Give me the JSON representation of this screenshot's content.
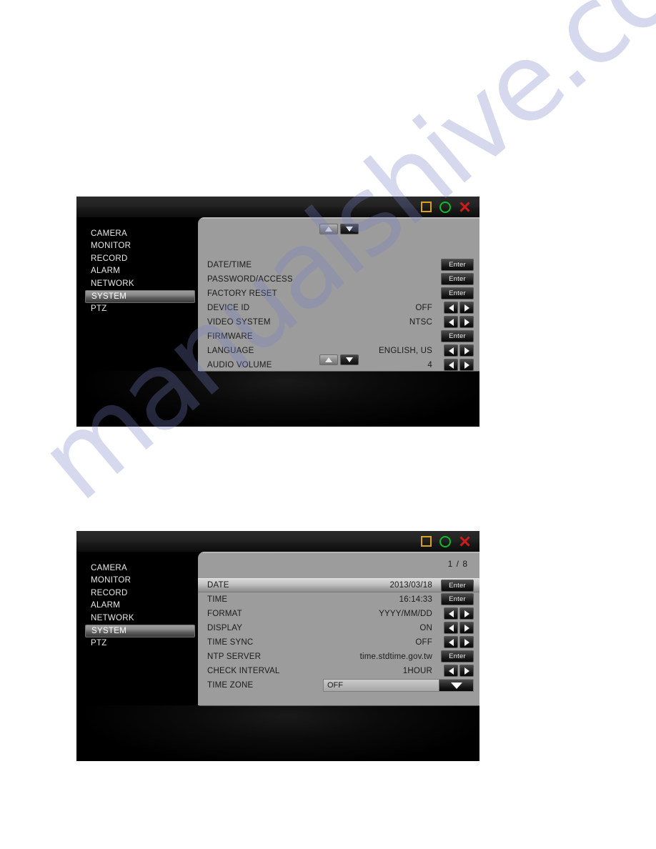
{
  "watermark": {
    "text": "manualshive.com"
  },
  "colors": {
    "restore_icon": "#d8a21e",
    "circle_icon": "#0ebc2a",
    "close_icon": "#cf1b1b",
    "panel_bg": "#9c9c9c",
    "sidebar_bg": "#000000"
  },
  "window_controls": {
    "restore": "restore-icon",
    "minimize": "circle-icon",
    "close": "close-icon"
  },
  "sidebar": {
    "items": [
      {
        "label": "CAMERA",
        "active": false
      },
      {
        "label": "MONITOR",
        "active": false
      },
      {
        "label": "RECORD",
        "active": false
      },
      {
        "label": "ALARM",
        "active": false
      },
      {
        "label": "NETWORK",
        "active": false
      },
      {
        "label": "SYSTEM",
        "active": true
      },
      {
        "label": "PTZ",
        "active": false
      }
    ]
  },
  "screen1": {
    "scroll_up_label": "scroll-up",
    "scroll_down_label": "scroll-down",
    "rows": [
      {
        "label": "DATE/TIME",
        "value": "",
        "control": "enter",
        "enter_label": "Enter"
      },
      {
        "label": "PASSWORD/ACCESS",
        "value": "",
        "control": "enter",
        "enter_label": "Enter"
      },
      {
        "label": "FACTORY RESET",
        "value": "",
        "control": "enter",
        "enter_label": "Enter"
      },
      {
        "label": "DEVICE ID",
        "value": "OFF",
        "control": "arrows"
      },
      {
        "label": "VIDEO SYSTEM",
        "value": "NTSC",
        "control": "arrows"
      },
      {
        "label": "FIRMWARE",
        "value": "",
        "control": "enter",
        "enter_label": "Enter"
      },
      {
        "label": "LANGUAGE",
        "value": "ENGLISH, US",
        "control": "arrows"
      },
      {
        "label": "AUDIO VOLUME",
        "value": "4",
        "control": "arrows"
      }
    ]
  },
  "screen2": {
    "page_indicator": "1 / 8",
    "rows": [
      {
        "label": "DATE",
        "value": "2013/03/18",
        "control": "enter",
        "enter_label": "Enter",
        "highlighted": true
      },
      {
        "label": "TIME",
        "value": "16:14:33",
        "control": "enter",
        "enter_label": "Enter",
        "highlighted": false
      },
      {
        "label": "FORMAT",
        "value": "YYYY/MM/DD",
        "control": "arrows",
        "highlighted": false
      },
      {
        "label": "DISPLAY",
        "value": "ON",
        "control": "arrows",
        "highlighted": false
      },
      {
        "label": "TIME SYNC",
        "value": "OFF",
        "control": "arrows",
        "highlighted": false
      },
      {
        "label": "NTP SERVER",
        "value": "time.stdtime.gov.tw",
        "control": "enter",
        "enter_label": "Enter",
        "highlighted": false
      },
      {
        "label": "CHECK INTERVAL",
        "value": "1HOUR",
        "control": "arrows",
        "highlighted": false
      },
      {
        "label": "TIME ZONE",
        "value": "",
        "control": "dropdown",
        "dropdown_value": "OFF",
        "highlighted": false
      }
    ]
  }
}
